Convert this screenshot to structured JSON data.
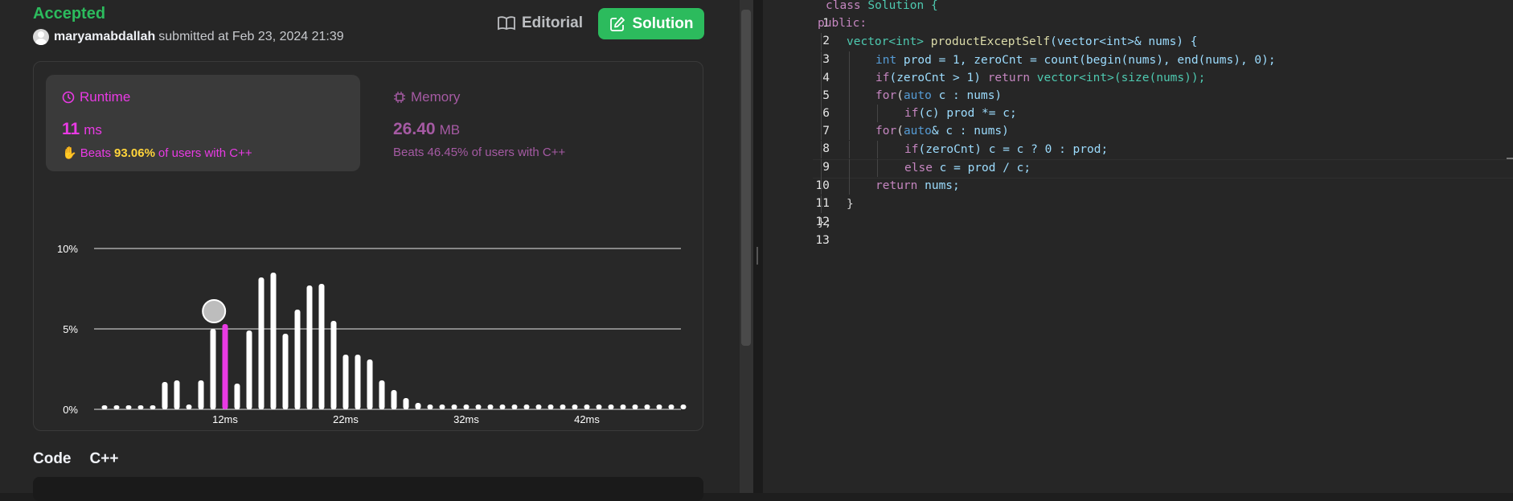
{
  "submission": {
    "status": "Accepted",
    "username": "maryamabdallah",
    "submitted_text": "submitted at Feb 23, 2024 21:39",
    "editorial_label": "Editorial",
    "solution_label": "Solution"
  },
  "runtime": {
    "label": "Runtime",
    "value": "11",
    "unit": "ms",
    "beats_prefix": "Beats",
    "beats_pct": "93.06%",
    "beats_suffix": "of users with C++"
  },
  "memory": {
    "label": "Memory",
    "value": "26.40",
    "unit": "MB",
    "beats_text": "Beats 46.45% of users with C++"
  },
  "chart_data": {
    "type": "bar",
    "y_ticks": [
      "10%",
      "5%",
      "0%"
    ],
    "x_ticks": [
      "12ms",
      "22ms",
      "32ms",
      "42ms"
    ],
    "ylim": [
      0,
      10
    ],
    "highlight_index": 10,
    "values": [
      0.2,
      0.2,
      0.2,
      0.2,
      0.2,
      1.7,
      1.8,
      0.3,
      1.8,
      5.0,
      5.3,
      1.6,
      4.9,
      8.2,
      8.5,
      4.7,
      6.2,
      7.7,
      7.8,
      5.5,
      3.4,
      3.4,
      3.1,
      1.8,
      1.2,
      0.7,
      0.4,
      0.3,
      0.3,
      0.3,
      0.3,
      0.3,
      0.3,
      0.3,
      0.3,
      0.3,
      0.3,
      0.3,
      0.3,
      0.3,
      0.3,
      0.3,
      0.3,
      0.3,
      0.3,
      0.3,
      0.3,
      0.3,
      0.3
    ],
    "colors": {
      "bar": "#ffffff",
      "highlight": "#e93ae4"
    }
  },
  "code_section": {
    "title": "Code",
    "language": "C++"
  },
  "code_lines": [
    {
      "n": "1"
    },
    {
      "n": "2"
    },
    {
      "n": "3"
    },
    {
      "n": "4"
    },
    {
      "n": "5"
    },
    {
      "n": "6"
    },
    {
      "n": "7"
    },
    {
      "n": "8"
    },
    {
      "n": "9"
    },
    {
      "n": "10"
    },
    {
      "n": "11"
    },
    {
      "n": "12"
    },
    {
      "n": "13"
    }
  ],
  "code": {
    "l1": {
      "kw": "class",
      "rest": " Solution {"
    },
    "l2": {
      "text": "public:"
    },
    "l3": {
      "type": "vector<int>",
      "fn": " productExceptSelf",
      "args": "(vector<int>& nums) {"
    },
    "l4": {
      "kw": "int",
      "rest": " prod = 1, zeroCnt = count(begin(nums), end(nums), 0);"
    },
    "l5": {
      "kw": "if",
      "rest": "(zeroCnt > 1) ",
      "kw2": "return",
      "rest2": " vector<int>(size(nums));"
    },
    "l6": {
      "kw": "for",
      "rest": "(",
      "kw2": "auto",
      "rest2": " c : nums)"
    },
    "l7": {
      "kw": "if",
      "rest": "(c) prod *= c;"
    },
    "l8": {
      "kw": "for",
      "rest": "(",
      "kw2": "auto",
      "rest2": "& c : nums)"
    },
    "l9": {
      "kw": "if",
      "rest": "(zeroCnt) c = c ? 0 : prod;"
    },
    "l10": {
      "kw": "else",
      "rest": " c = prod / c;"
    },
    "l11": {
      "kw": "return",
      "rest": " nums;"
    },
    "l12": {
      "text": "}"
    },
    "l13": {
      "text": "};"
    }
  },
  "colors": {
    "accent_green": "#2cbb5d",
    "runtime_pink": "#e93ae4",
    "beats_yellow": "#ffd43b"
  }
}
